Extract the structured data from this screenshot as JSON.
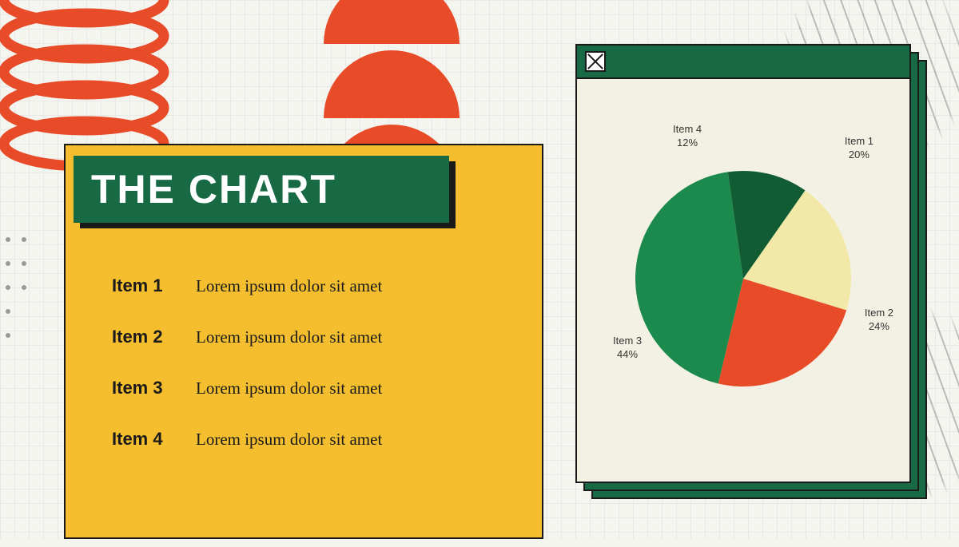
{
  "title": "THE CHART",
  "items": [
    {
      "label": "Item 1",
      "desc": "Lorem ipsum dolor sit amet"
    },
    {
      "label": "Item 2",
      "desc": "Lorem ipsum dolor sit amet"
    },
    {
      "label": "Item 3",
      "desc": "Lorem ipsum dolor sit amet"
    },
    {
      "label": "Item 4",
      "desc": "Lorem ipsum dolor sit amet"
    }
  ],
  "chart_data": {
    "type": "pie",
    "title": "",
    "series": [
      {
        "name": "Item 1",
        "value": 20,
        "label": "Item 1\n20%",
        "color": "#F2E9A8"
      },
      {
        "name": "Item 2",
        "value": 24,
        "label": "Item 2\n24%",
        "color": "#E84B28"
      },
      {
        "name": "Item 3",
        "value": 44,
        "label": "Item 3\n44%",
        "color": "#1B8A4C"
      },
      {
        "name": "Item 4",
        "value": 12,
        "label": "Item 4\n12%",
        "color": "#125C34"
      }
    ]
  },
  "labels": {
    "l1a": "Item 1",
    "l1b": "20%",
    "l2a": "Item 2",
    "l2b": "24%",
    "l3a": "Item 3",
    "l3b": "44%",
    "l4a": "Item 4",
    "l4b": "12%"
  },
  "colors": {
    "green": "#186A44",
    "darkgreen": "#125C34",
    "brightgreen": "#1B8A4C",
    "orange": "#E84B28",
    "yellow": "#F5BE2F",
    "cream": "#F2E9A8"
  }
}
